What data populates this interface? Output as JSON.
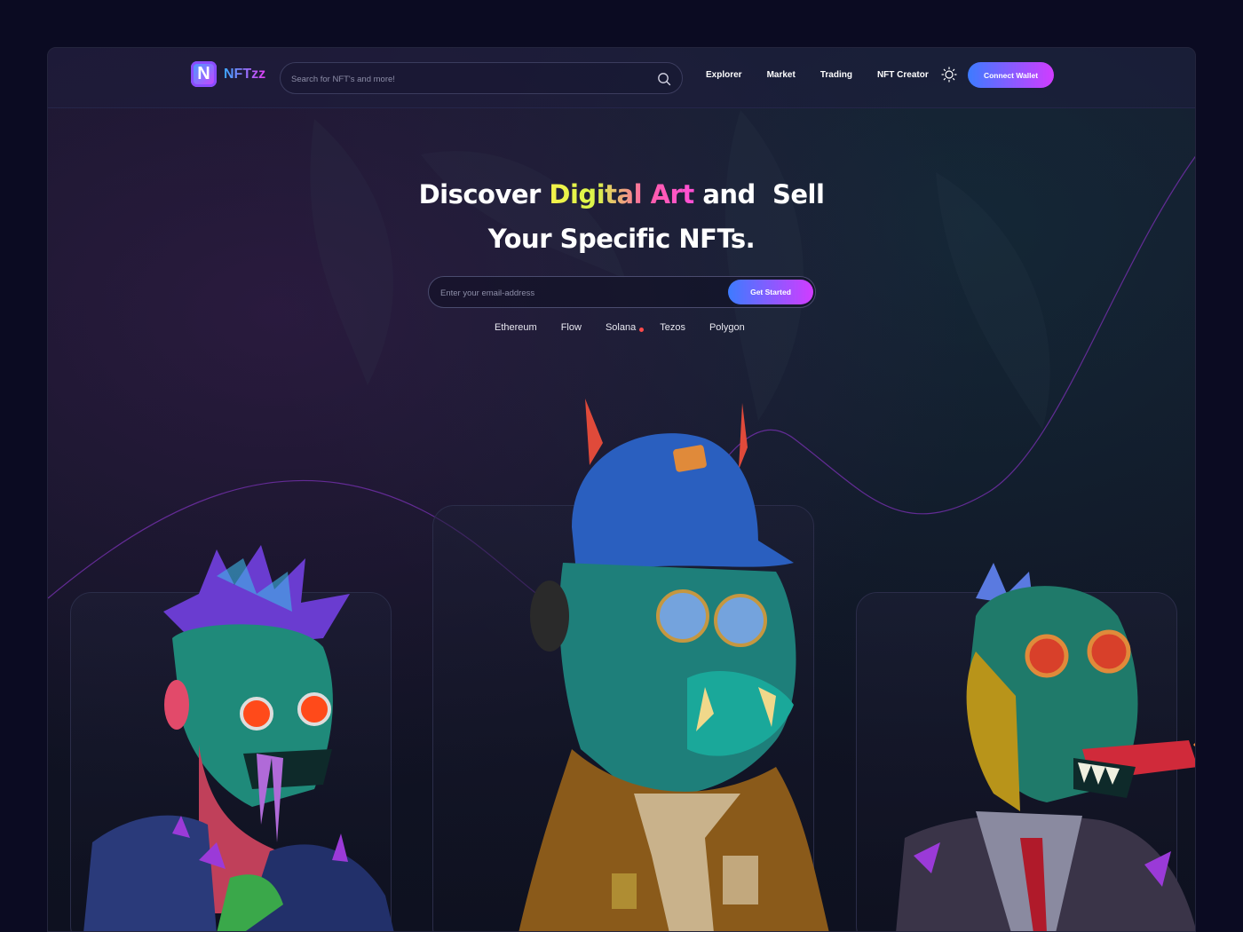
{
  "brand": {
    "logo_letter": "N",
    "name": "NFTzz"
  },
  "search": {
    "placeholder": "Search for NFT's and more!"
  },
  "nav": {
    "items": [
      "Explorer",
      "Market",
      "Trading",
      "NFT Creator"
    ]
  },
  "header": {
    "connect_label": "Connect Wallet"
  },
  "hero": {
    "title_line1_a": "Discover ",
    "title_line1_highlight": "Digital Art",
    "title_line1_b": " and  Sell",
    "title_line2": "Your Specific NFTs.",
    "email_placeholder": "Enter your email-address",
    "cta_label": "Get Started"
  },
  "chains": [
    "Ethereum",
    "Flow",
    "Solana",
    "Tezos",
    "Polygon"
  ],
  "icons": {
    "search": "search-icon",
    "theme": "sun-icon"
  },
  "colors": {
    "background": "#0b0b22",
    "accent_start": "#3d7bff",
    "accent_end": "#d13cff",
    "status_dot": "#ff4a4a"
  }
}
